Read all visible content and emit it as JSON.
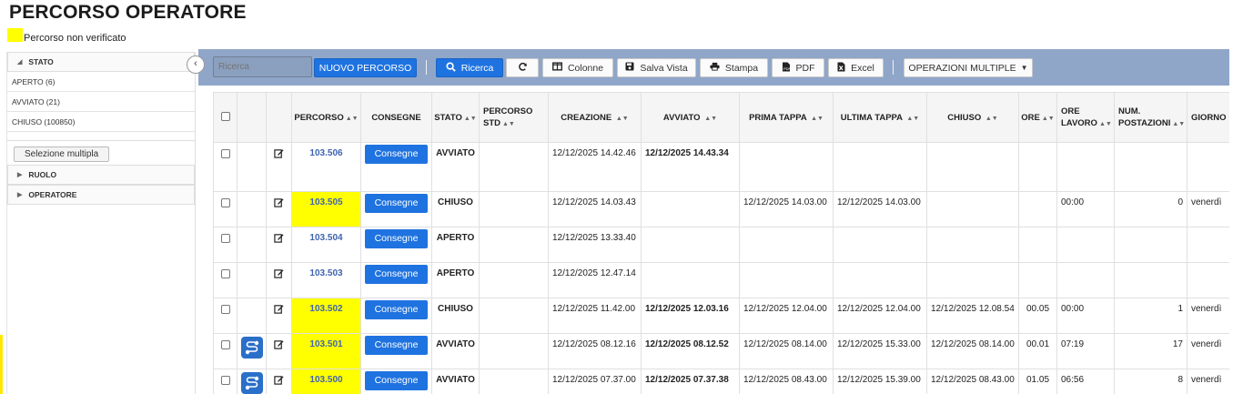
{
  "page": {
    "title": "PERCORSO OPERATORE",
    "legend_label": "Percorso non verificato",
    "legend_color": "#ffff00"
  },
  "sidebar": {
    "facets": [
      {
        "label": "STATO",
        "expanded": true,
        "items": [
          "APERTO (6)",
          "AVVIATO (21)",
          "CHIUSO (100850)"
        ]
      },
      {
        "label": "RUOLO",
        "expanded": false,
        "items": []
      },
      {
        "label": "OPERATORE",
        "expanded": false,
        "items": []
      }
    ],
    "multi_select_label": "Selezione multipla",
    "collapse_icon": "chevron-left-icon"
  },
  "toolbar": {
    "search_placeholder": "Ricerca",
    "new_label": "NUOVO PERCORSO",
    "search_label": "Ricerca",
    "refresh_icon": "refresh-icon",
    "columns_label": "Colonne",
    "save_view_label": "Salva Vista",
    "print_label": "Stampa",
    "pdf_label": "PDF",
    "excel_label": "Excel",
    "bulk_label": "OPERAZIONI MULTIPLE",
    "bg_color": "#8fa6c9",
    "accent": "#1f73e0"
  },
  "table": {
    "headers": {
      "percorso": "PERCORSO",
      "consegne": "CONSEGNE",
      "stato": "STATO",
      "percorso_std": "PERCORSO STD",
      "creazione": "CREAZIONE",
      "avviato": "AVVIATO",
      "prima_tappa": "PRIMA TAPPA",
      "ultima_tappa": "ULTIMA TAPPA",
      "chiuso": "CHIUSO",
      "ore": "ORE",
      "ore_lavoro": "ORE LAVORO",
      "num_postazioni": "NUM. POSTAZIONI",
      "giorno": "GIORNO"
    },
    "consegne_label": "Consegne",
    "rows": [
      {
        "code": "103.506",
        "unverified": false,
        "route_icon": false,
        "stato": "AVVIATO",
        "creazione": "12/12/2025 14.42.46",
        "avviato": "12/12/2025 14.43.34",
        "prima": "",
        "ultima": "",
        "chiuso": "",
        "ore": "",
        "ore_lavoro": "",
        "postazioni": "",
        "giorno": ""
      },
      {
        "code": "103.505",
        "unverified": true,
        "route_icon": false,
        "stato": "CHIUSO",
        "creazione": "12/12/2025 14.03.43",
        "avviato": "",
        "prima": "12/12/2025 14.03.00",
        "ultima": "12/12/2025 14.03.00",
        "chiuso": "",
        "ore": "",
        "ore_lavoro": "00:00",
        "postazioni": "0",
        "giorno": "venerdì"
      },
      {
        "code": "103.504",
        "unverified": false,
        "route_icon": false,
        "stato": "APERTO",
        "creazione": "12/12/2025 13.33.40",
        "avviato": "",
        "prima": "",
        "ultima": "",
        "chiuso": "",
        "ore": "",
        "ore_lavoro": "",
        "postazioni": "",
        "giorno": ""
      },
      {
        "code": "103.503",
        "unverified": false,
        "route_icon": false,
        "stato": "APERTO",
        "creazione": "12/12/2025 12.47.14",
        "avviato": "",
        "prima": "",
        "ultima": "",
        "chiuso": "",
        "ore": "",
        "ore_lavoro": "",
        "postazioni": "",
        "giorno": ""
      },
      {
        "code": "103.502",
        "unverified": true,
        "route_icon": false,
        "stato": "CHIUSO",
        "creazione": "12/12/2025 11.42.00",
        "avviato": "12/12/2025 12.03.16",
        "prima": "12/12/2025 12.04.00",
        "ultima": "12/12/2025 12.04.00",
        "chiuso": "12/12/2025 12.08.54",
        "ore": "00.05",
        "ore_lavoro": "00:00",
        "postazioni": "1",
        "giorno": "venerdì"
      },
      {
        "code": "103.501",
        "unverified": true,
        "route_icon": true,
        "stato": "AVVIATO",
        "creazione": "12/12/2025 08.12.16",
        "avviato": "12/12/2025 08.12.52",
        "prima": "12/12/2025 08.14.00",
        "ultima": "12/12/2025 15.33.00",
        "chiuso": "12/12/2025 08.14.00",
        "ore": "00.01",
        "ore_lavoro": "07:19",
        "postazioni": "17",
        "giorno": "venerdì"
      },
      {
        "code": "103.500",
        "unverified": true,
        "route_icon": true,
        "stato": "AVVIATO",
        "creazione": "12/12/2025 07.37.00",
        "avviato": "12/12/2025 07.37.38",
        "prima": "12/12/2025 08.43.00",
        "ultima": "12/12/2025 15.39.00",
        "chiuso": "12/12/2025 08.43.00",
        "ore": "01.05",
        "ore_lavoro": "06:56",
        "postazioni": "8",
        "giorno": "venerdì"
      }
    ]
  }
}
